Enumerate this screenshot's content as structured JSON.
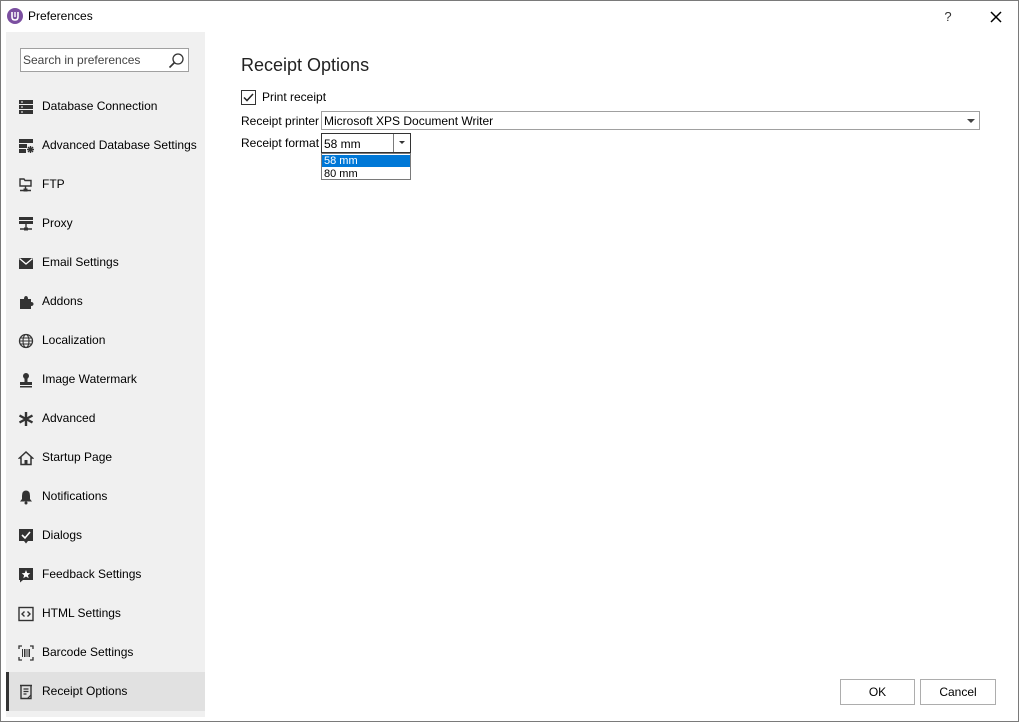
{
  "window": {
    "title": "Preferences",
    "help_label": "?",
    "icons": {
      "app": "app-logo-icon",
      "close": "close-icon"
    }
  },
  "sidebar": {
    "search_placeholder": "Search in preferences",
    "search_icon": "search-icon",
    "items": [
      {
        "label": "Database Connection",
        "icon": "database-icon",
        "active": false
      },
      {
        "label": "Advanced Database Settings",
        "icon": "database-settings-icon",
        "active": false
      },
      {
        "label": "FTP",
        "icon": "ftp-icon",
        "active": false
      },
      {
        "label": "Proxy",
        "icon": "proxy-icon",
        "active": false
      },
      {
        "label": "Email Settings",
        "icon": "email-icon",
        "active": false
      },
      {
        "label": "Addons",
        "icon": "puzzle-icon",
        "active": false
      },
      {
        "label": "Localization",
        "icon": "globe-icon",
        "active": false
      },
      {
        "label": "Image Watermark",
        "icon": "stamp-icon",
        "active": false
      },
      {
        "label": "Advanced",
        "icon": "asterisk-icon",
        "active": false
      },
      {
        "label": "Startup Page",
        "icon": "home-icon",
        "active": false
      },
      {
        "label": "Notifications",
        "icon": "bell-icon",
        "active": false
      },
      {
        "label": "Dialogs",
        "icon": "dialog-check-icon",
        "active": false
      },
      {
        "label": "Feedback Settings",
        "icon": "feedback-star-icon",
        "active": false
      },
      {
        "label": "HTML Settings",
        "icon": "code-icon",
        "active": false
      },
      {
        "label": "Barcode Settings",
        "icon": "barcode-icon",
        "active": false
      },
      {
        "label": "Receipt Options",
        "icon": "receipt-icon",
        "active": true
      }
    ]
  },
  "main": {
    "title": "Receipt Options",
    "print_receipt": {
      "label": "Print receipt",
      "checked": true
    },
    "receipt_printer": {
      "label": "Receipt printer",
      "value": "Microsoft XPS Document Writer"
    },
    "receipt_format": {
      "label": "Receipt format",
      "value": "58 mm",
      "options": [
        "58 mm",
        "80 mm"
      ],
      "highlighted_index": 0
    }
  },
  "footer": {
    "ok_label": "OK",
    "cancel_label": "Cancel"
  },
  "colors": {
    "accent": "#7b4fa0",
    "selection": "#0078d7",
    "sidebar_bg": "#f0f0f0",
    "active_item_bg": "#e1e1e1"
  }
}
